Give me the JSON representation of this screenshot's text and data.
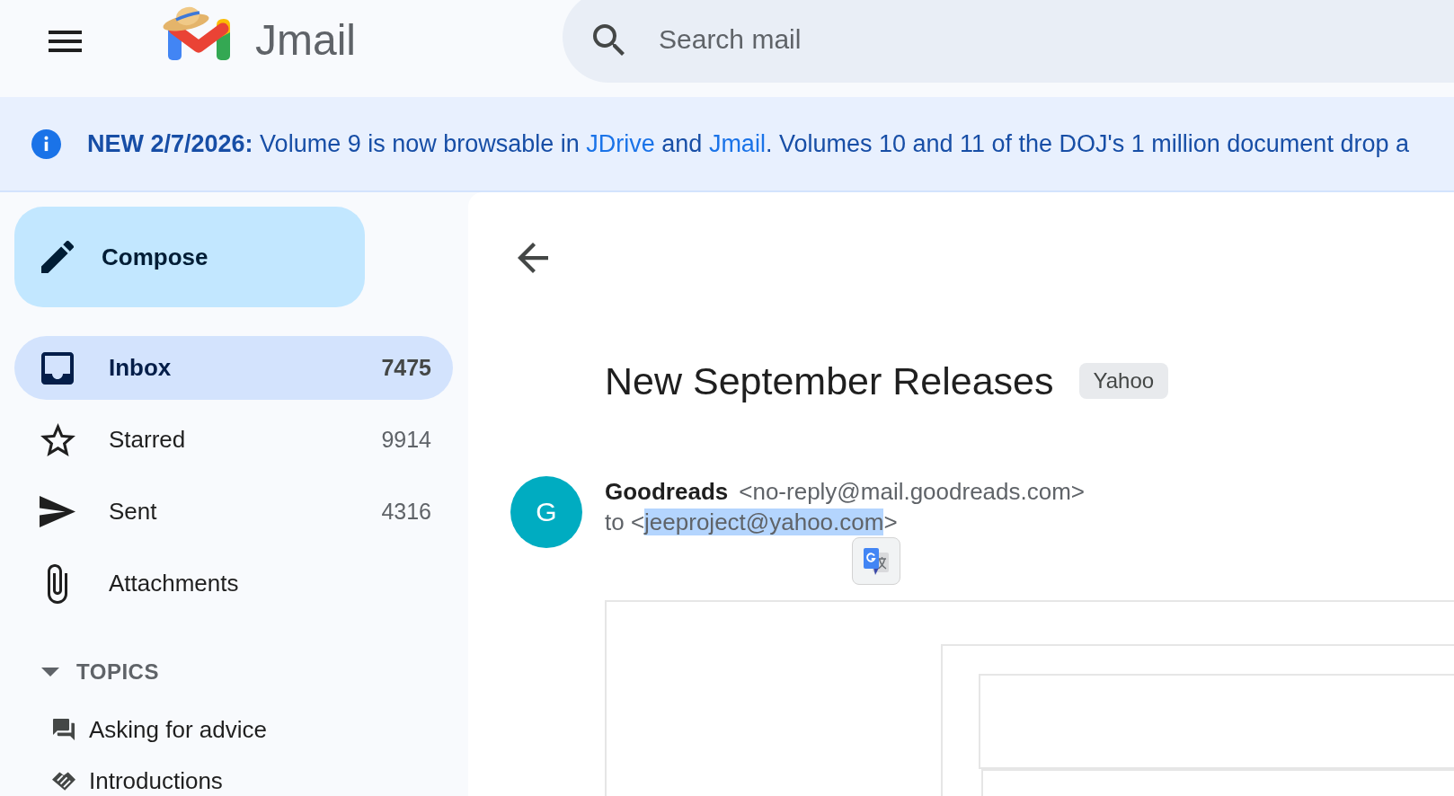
{
  "header": {
    "app_name": "Jmail",
    "search": {
      "placeholder": "Search mail"
    }
  },
  "banner": {
    "segments": [
      {
        "kind": "bold",
        "text": "NEW 2/7/2026:"
      },
      {
        "kind": "text",
        "text": " Volume 9 is now browsable in "
      },
      {
        "kind": "link",
        "text": "JDrive"
      },
      {
        "kind": "text",
        "text": " and "
      },
      {
        "kind": "link",
        "text": "Jmail"
      },
      {
        "kind": "text",
        "text": ". Volumes 10 and 11 of the DOJ's 1 million document drop a"
      }
    ]
  },
  "sidebar": {
    "compose": {
      "label": "Compose"
    },
    "items": [
      {
        "label": "Inbox",
        "count": "7475",
        "selected": true
      },
      {
        "label": "Starred",
        "count": "9914",
        "selected": false
      },
      {
        "label": "Sent",
        "count": "4316",
        "selected": false
      },
      {
        "label": "Attachments",
        "selected": false
      }
    ],
    "section": {
      "title": "TOPICS",
      "expanded": true,
      "items": [
        {
          "label": "Asking for advice"
        },
        {
          "label": "Introductions"
        }
      ]
    }
  },
  "message": {
    "subject": "New September Releases",
    "label": "Yahoo",
    "sender": {
      "initial": "G",
      "name": "Goodreads",
      "address": "<no-reply@mail.goodreads.com>"
    },
    "recipient": {
      "prefix": "to <",
      "address": "jeeproject@yahoo.com",
      "suffix": ">",
      "highlighted": true
    }
  }
}
